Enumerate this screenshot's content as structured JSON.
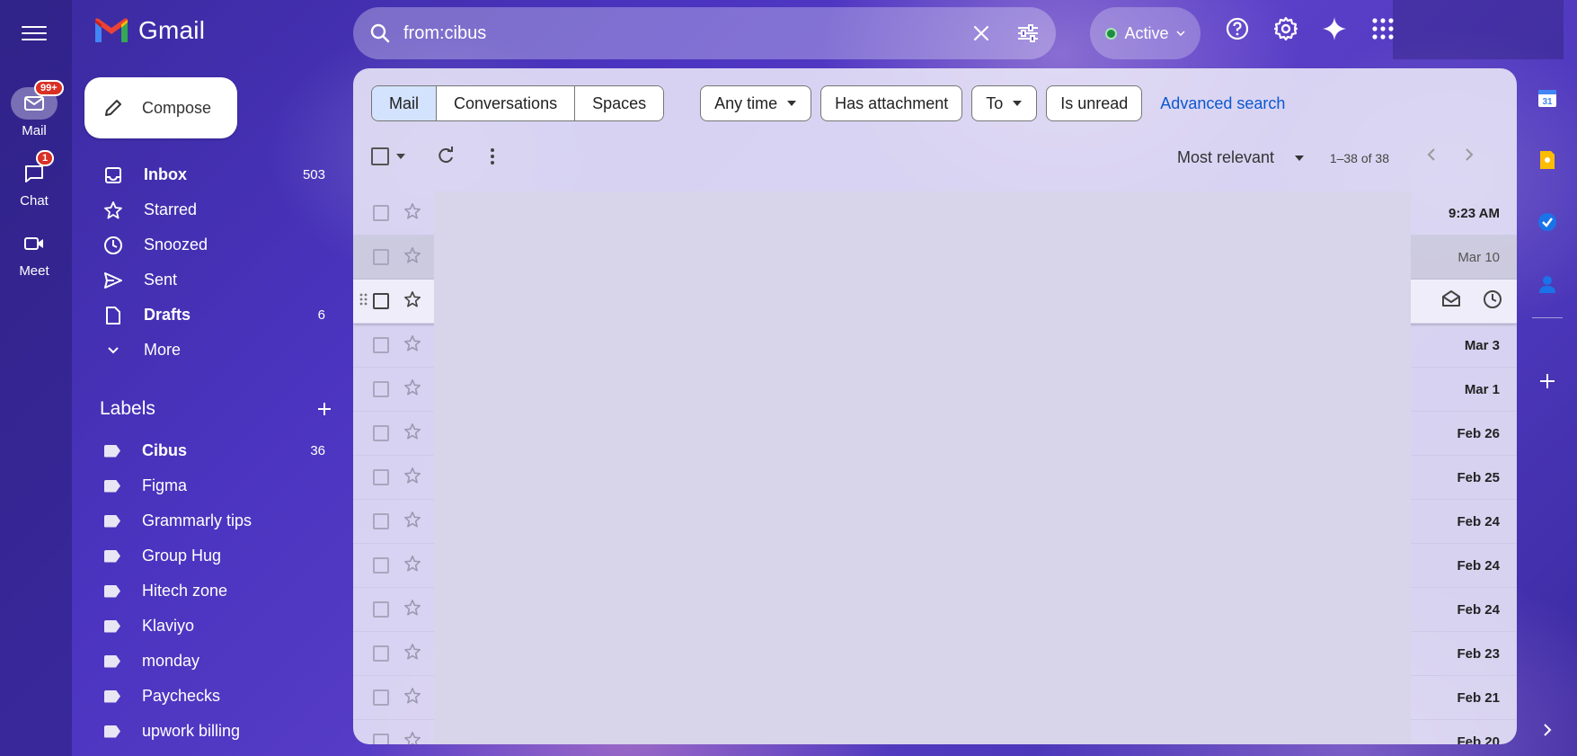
{
  "app": {
    "name": "Gmail"
  },
  "rail": {
    "mail": {
      "label": "Mail",
      "badge": "99+"
    },
    "chat": {
      "label": "Chat",
      "badge": "1"
    },
    "meet": {
      "label": "Meet"
    }
  },
  "search": {
    "value": "from:cibus"
  },
  "status": {
    "label": "Active"
  },
  "compose": {
    "label": "Compose"
  },
  "nav": [
    {
      "label": "Inbox",
      "count": "503",
      "bold": true
    },
    {
      "label": "Starred",
      "count": "",
      "bold": false
    },
    {
      "label": "Snoozed",
      "count": "",
      "bold": false
    },
    {
      "label": "Sent",
      "count": "",
      "bold": false
    },
    {
      "label": "Drafts",
      "count": "6",
      "bold": true
    },
    {
      "label": "More",
      "count": "",
      "bold": false
    }
  ],
  "labels": {
    "heading": "Labels",
    "items": [
      {
        "label": "Cibus",
        "count": "36",
        "bold": true
      },
      {
        "label": "Figma",
        "count": ""
      },
      {
        "label": "Grammarly tips",
        "count": ""
      },
      {
        "label": "Group Hug",
        "count": ""
      },
      {
        "label": "Hitech zone",
        "count": ""
      },
      {
        "label": "Klaviyo",
        "count": ""
      },
      {
        "label": "monday",
        "count": ""
      },
      {
        "label": "Paychecks",
        "count": ""
      },
      {
        "label": "upwork billing",
        "count": ""
      }
    ]
  },
  "filters": {
    "segments": [
      "Mail",
      "Conversations",
      "Spaces"
    ],
    "any_time": "Any time",
    "has_attachment": "Has attachment",
    "to": "To",
    "is_unread": "Is unread",
    "advanced": "Advanced search"
  },
  "toolbar": {
    "sort": "Most relevant",
    "pager": "1–38 of 38"
  },
  "emails": [
    {
      "date": "9:23 AM",
      "read": false
    },
    {
      "date": "Mar 10",
      "read": true
    },
    {
      "date": "",
      "read": false,
      "hover": true
    },
    {
      "date": "Mar 3",
      "read": false
    },
    {
      "date": "Mar 1",
      "read": false
    },
    {
      "date": "Feb 26",
      "read": false
    },
    {
      "date": "Feb 25",
      "read": false
    },
    {
      "date": "Feb 24",
      "read": false
    },
    {
      "date": "Feb 24",
      "read": false
    },
    {
      "date": "Feb 24",
      "read": false
    },
    {
      "date": "Feb 23",
      "read": false
    },
    {
      "date": "Feb 21",
      "read": false
    },
    {
      "date": "Feb 20",
      "read": false
    }
  ],
  "colors": {
    "accent_blue": "#0b57d0",
    "badge_red": "#d93025",
    "active_green": "#1e8e3e"
  }
}
